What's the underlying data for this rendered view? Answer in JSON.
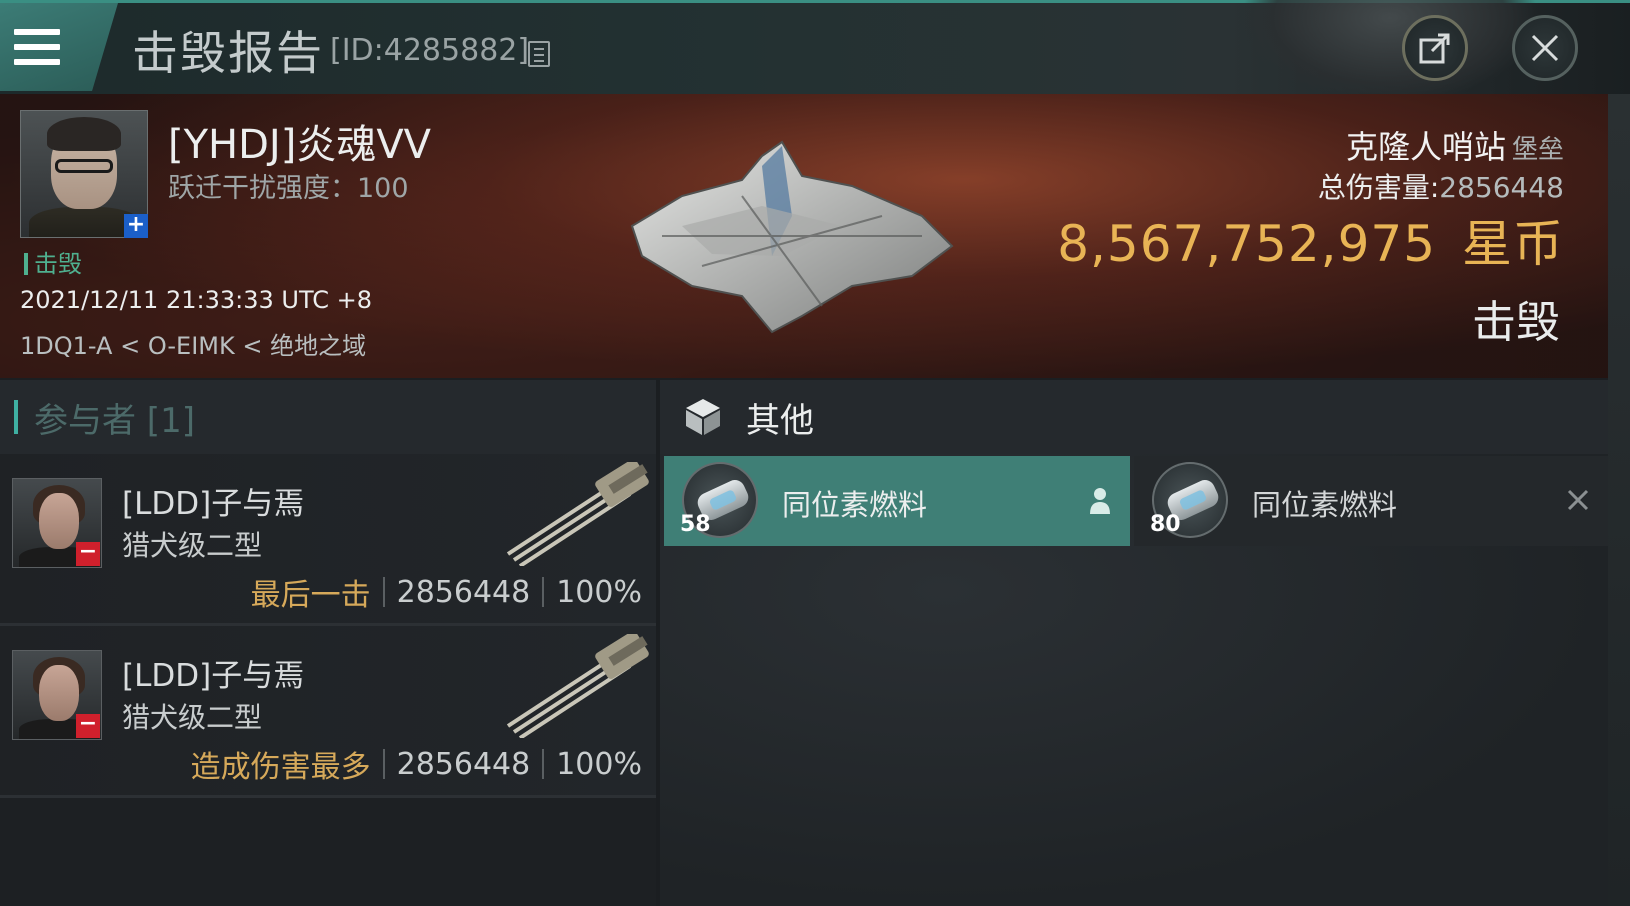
{
  "header": {
    "title": "击毁报告",
    "report_id": "[ID:4285882]"
  },
  "victim": {
    "name": "[YHDJ]炎魂VV",
    "jam_label": "跃迁干扰强度：100",
    "status": "击毁",
    "datetime": "2021/12/11 21:33:33 UTC +8",
    "location": "1DQ1-A < O-EIMK < 绝地之域",
    "ship_name": "克隆人哨站",
    "ship_type": "堡垒",
    "total_damage_label": "总伤害量:",
    "total_damage_value": "2856448",
    "isk_value": "8,567,752,975",
    "isk_unit": "星币",
    "result": "击毁"
  },
  "participants": {
    "header": "参与者 [1]",
    "rows": [
      {
        "name": "[LDD]子与焉",
        "ship": "猎犬级二型",
        "role": "最后一击",
        "damage": "2856448",
        "percent": "100%"
      },
      {
        "name": "[LDD]子与焉",
        "ship": "猎犬级二型",
        "role": "造成伤害最多",
        "damage": "2856448",
        "percent": "100%"
      }
    ]
  },
  "items": {
    "header": "其他",
    "dropped": {
      "name": "同位素燃料",
      "qty": "58"
    },
    "destroyed": {
      "name": "同位素燃料",
      "qty": "80"
    }
  },
  "colors": {
    "accent": "#3fb0a2",
    "isk": "#e8b455",
    "role": "#d6a95a",
    "dropped_bg": "#3f7f76"
  }
}
